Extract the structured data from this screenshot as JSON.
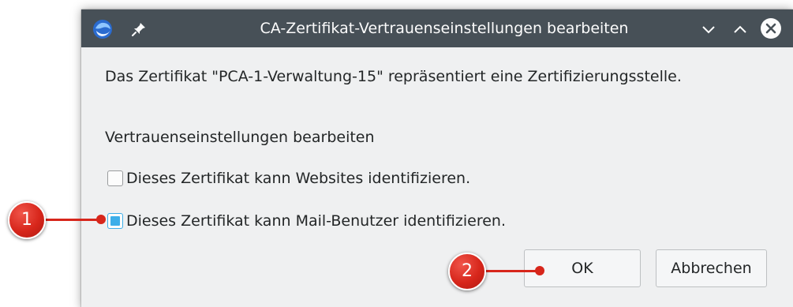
{
  "window": {
    "title": "CA-Zertifikat-Vertrauenseinstellungen bearbeiten",
    "app_icon": "thunderbird-icon",
    "pin_icon": "pin-icon",
    "controls": [
      "chevron-down-icon",
      "chevron-up-icon",
      "close-icon"
    ]
  },
  "dialog": {
    "info_text": "Das Zertifikat \"PCA-1-Verwaltung-15\" repräsentiert eine Zertifizierungsstelle.",
    "section_label": "Vertrauenseinstellungen bearbeiten",
    "options": [
      {
        "label": "Dieses Zertifikat kann Websites identifizieren.",
        "checked": false
      },
      {
        "label": "Dieses Zertifikat kann Mail-Benutzer identifizieren.",
        "checked": true
      }
    ],
    "ok_label": "OK",
    "cancel_label": "Abbrechen"
  },
  "annotations": {
    "callout_1": "1",
    "callout_2": "2"
  },
  "colors": {
    "titlebar": "#475057",
    "accent": "#3daee9",
    "callout": "#d7261b",
    "window_bg": "#eff0f1"
  }
}
